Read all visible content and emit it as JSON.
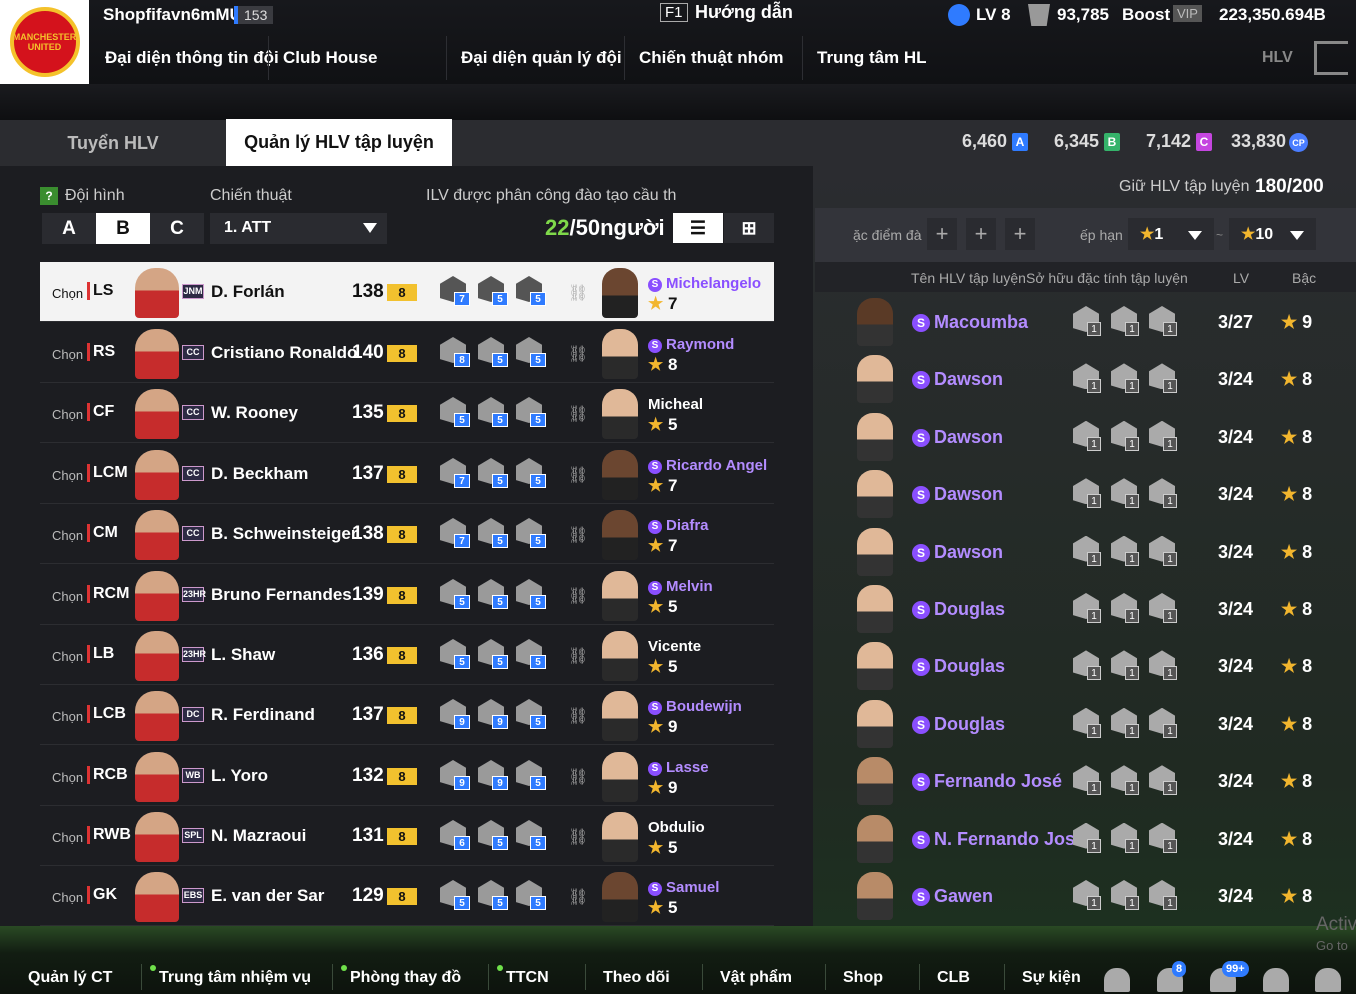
{
  "header": {
    "username": "Shopfifavn6mMU",
    "user_level": "153",
    "f1_key": "F1",
    "guide": "Hướng dẫn",
    "lv": "LV 8",
    "coins": "93,785",
    "boost": "Boost",
    "vip": "VIP",
    "bp": "223,350.694B"
  },
  "nav": [
    "Đại diện thông tin đội",
    "Club House",
    "Đại diện quản lý đội",
    "Chiến thuật nhóm",
    "Trung tâm HL"
  ],
  "nav_right": "HLV",
  "logo_text": "MANCHESTER UNITED",
  "tabs": {
    "recruit": "Tuyển HLV",
    "manage": "Quản lý HLV tập luyện"
  },
  "currencies": [
    {
      "value": "6,460",
      "badge": "A",
      "color": "#2f7bff"
    },
    {
      "value": "6,345",
      "badge": "B",
      "color": "#35b36a"
    },
    {
      "value": "7,142",
      "badge": "C",
      "color": "#c546e0"
    },
    {
      "value": "33,830",
      "badge": "CP",
      "color": "#4a7dff"
    }
  ],
  "left": {
    "formation_label": "Đội hình",
    "formation_help": "?",
    "formations": [
      "A",
      "B",
      "C"
    ],
    "tactic_label": "Chiến thuật",
    "tactic_value": "1. ATT",
    "assign_label": "ILV được phân công đào tạo cầu th",
    "assigned": "22",
    "assigned_total": "/50người"
  },
  "players": [
    {
      "chon": "Chọn",
      "pos": "LS",
      "season": "JNM",
      "name": "D. Forlán",
      "ovr": "138",
      "grade": "8",
      "traits": [
        "7",
        "5",
        "5"
      ],
      "coach": "Michelangelo",
      "special": true,
      "stars": "7",
      "dark": true,
      "selected": true
    },
    {
      "chon": "Chọn",
      "pos": "RS",
      "season": "CC",
      "name": "Cristiano Ronaldo",
      "ovr": "140",
      "grade": "8",
      "traits": [
        "8",
        "5",
        "5"
      ],
      "coach": "Raymond",
      "special": true,
      "stars": "8",
      "dark": false
    },
    {
      "chon": "Chọn",
      "pos": "CF",
      "season": "CC",
      "name": "W. Rooney",
      "ovr": "135",
      "grade": "8",
      "traits": [
        "5",
        "5",
        "5"
      ],
      "coach": "Micheal",
      "special": false,
      "stars": "5",
      "dark": false
    },
    {
      "chon": "Chọn",
      "pos": "LCM",
      "season": "CC",
      "name": "D. Beckham",
      "ovr": "137",
      "grade": "8",
      "traits": [
        "7",
        "5",
        "5"
      ],
      "coach": "Ricardo Angel",
      "special": true,
      "stars": "7",
      "dark": true
    },
    {
      "chon": "Chọn",
      "pos": "CM",
      "season": "CC",
      "name": "B. Schweinsteiger",
      "ovr": "138",
      "grade": "8",
      "traits": [
        "7",
        "5",
        "5"
      ],
      "coach": "Diafra",
      "special": true,
      "stars": "7",
      "dark": true
    },
    {
      "chon": "Chọn",
      "pos": "RCM",
      "season": "23HR",
      "name": "Bruno Fernandes",
      "ovr": "139",
      "grade": "8",
      "traits": [
        "5",
        "5",
        "5"
      ],
      "coach": "Melvin",
      "special": true,
      "stars": "5",
      "dark": false
    },
    {
      "chon": "Chọn",
      "pos": "LB",
      "season": "23HR",
      "name": "L. Shaw",
      "ovr": "136",
      "grade": "8",
      "traits": [
        "5",
        "5",
        "5"
      ],
      "coach": "Vicente",
      "special": false,
      "stars": "5",
      "dark": false
    },
    {
      "chon": "Chọn",
      "pos": "LCB",
      "season": "DC",
      "name": "R. Ferdinand",
      "ovr": "137",
      "grade": "8",
      "traits": [
        "9",
        "9",
        "5"
      ],
      "coach": "Boudewijn",
      "special": true,
      "stars": "9",
      "dark": false
    },
    {
      "chon": "Chọn",
      "pos": "RCB",
      "season": "WB",
      "name": "L. Yoro",
      "ovr": "132",
      "grade": "8",
      "traits": [
        "9",
        "9",
        "5"
      ],
      "coach": "Lasse",
      "special": true,
      "stars": "9",
      "dark": false
    },
    {
      "chon": "Chọn",
      "pos": "RWB",
      "season": "SPL",
      "name": "N. Mazraoui",
      "ovr": "131",
      "grade": "8",
      "traits": [
        "6",
        "5",
        "5"
      ],
      "coach": "Obdulio",
      "special": false,
      "stars": "5",
      "dark": false
    },
    {
      "chon": "Chọn",
      "pos": "GK",
      "season": "EBS",
      "name": "E. van der Sar",
      "ovr": "129",
      "grade": "8",
      "traits": [
        "5",
        "5",
        "5"
      ],
      "coach": "Samuel",
      "special": true,
      "stars": "5",
      "dark": true
    }
  ],
  "right": {
    "hold_label": "Giữ HLV tập luyện",
    "hold_value": "180/200",
    "filter_label1": "ặc điểm đà",
    "filter_label2": "ếp hạn",
    "dd1": "1",
    "dd_sep": "~",
    "dd2": "10",
    "col_name": "Tên HLV tập luyện",
    "col_traits": "Sở hữu đặc tính tập luyện",
    "col_lv": "LV",
    "col_rank": "Bậc"
  },
  "coaches": [
    {
      "name": "Macoumba",
      "lv": "3/27",
      "rank": "9",
      "skin": "d"
    },
    {
      "name": "Dawson",
      "lv": "3/24",
      "rank": "8",
      "skin": "l"
    },
    {
      "name": "Dawson",
      "lv": "3/24",
      "rank": "8",
      "skin": "l"
    },
    {
      "name": "Dawson",
      "lv": "3/24",
      "rank": "8",
      "skin": "l"
    },
    {
      "name": "Dawson",
      "lv": "3/24",
      "rank": "8",
      "skin": "l"
    },
    {
      "name": "Douglas",
      "lv": "3/24",
      "rank": "8",
      "skin": "l"
    },
    {
      "name": "Douglas",
      "lv": "3/24",
      "rank": "8",
      "skin": "l"
    },
    {
      "name": "Douglas",
      "lv": "3/24",
      "rank": "8",
      "skin": "l"
    },
    {
      "name": "Fernando José",
      "lv": "3/24",
      "rank": "8",
      "skin": "m"
    },
    {
      "name": "N. Fernando José",
      "lv": "3/24",
      "rank": "8",
      "skin": "m"
    },
    {
      "name": "Gawen",
      "lv": "3/24",
      "rank": "8",
      "skin": "m"
    }
  ],
  "coach_trait_level": "1",
  "bottom": {
    "items": [
      "Quản lý CT",
      "Trung tâm nhiệm vụ",
      "Phòng thay đồ",
      "TTCN",
      "Theo dõi",
      "Vật phẩm",
      "Shop",
      "CLB",
      "Sự kiện"
    ],
    "badge_home": "8",
    "badge_bell": "99+"
  },
  "watermark": {
    "line1": "Activ",
    "line2": "Go to"
  }
}
